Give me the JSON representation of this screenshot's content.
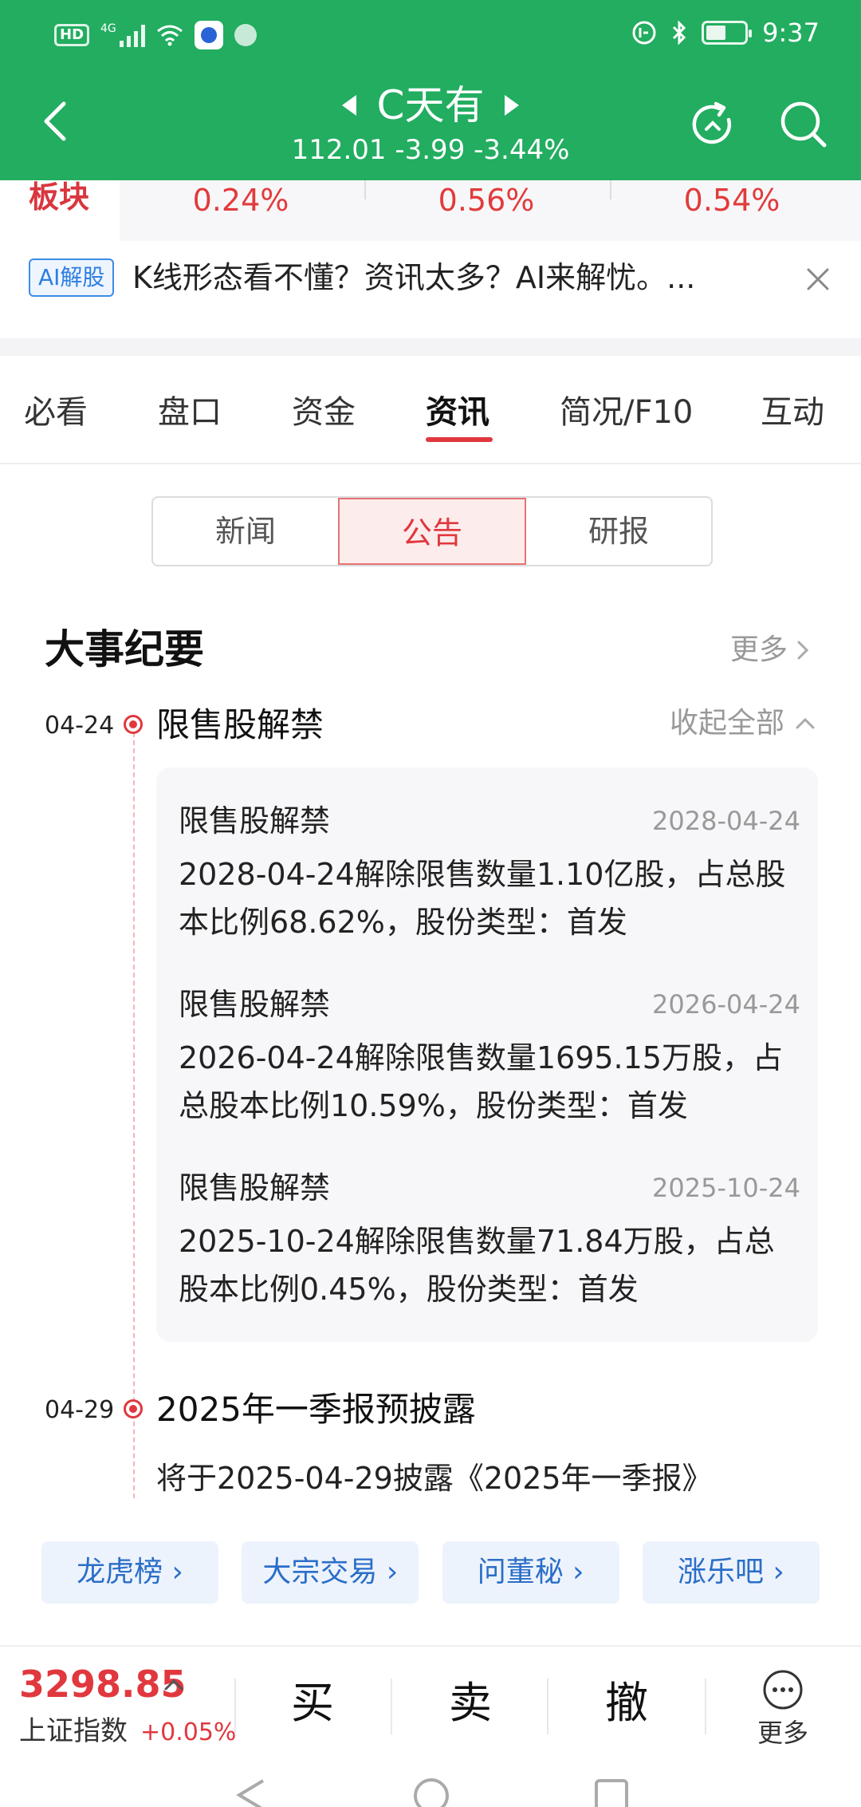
{
  "status_bar": {
    "left_badges": [
      "HD",
      "4G"
    ],
    "time": "9:37"
  },
  "header": {
    "title": "C天有",
    "quote": "112.01 -3.99 -3.44%"
  },
  "sector": {
    "label": "板块",
    "values": [
      "0.24%",
      "0.56%",
      "0.54%"
    ]
  },
  "ai_banner": {
    "badge": "AI解股",
    "text": "K线形态看不懂？资讯太多？AI来解忧。..."
  },
  "tabs": [
    "必看",
    "盘口",
    "资金",
    "资讯",
    "简况/F10",
    "互动"
  ],
  "active_tab": "资讯",
  "segments": [
    "新闻",
    "公告",
    "研报"
  ],
  "active_segment": "公告",
  "events_section": {
    "title": "大事纪要",
    "more": "更多",
    "events": [
      {
        "date": "04-24",
        "title": "限售股解禁",
        "collapse": "收起全部",
        "items": [
          {
            "title": "限售股解禁",
            "date": "2028-04-24",
            "desc": "2028-04-24解除限售数量1.10亿股，占总股本比例68.62%，股份类型：首发"
          },
          {
            "title": "限售股解禁",
            "date": "2026-04-24",
            "desc": "2026-04-24解除限售数量1695.15万股，占总股本比例10.59%，股份类型：首发"
          },
          {
            "title": "限售股解禁",
            "date": "2025-10-24",
            "desc": "2025-10-24解除限售数量71.84万股，占总股本比例0.45%，股份类型：首发"
          }
        ]
      },
      {
        "date": "04-29",
        "title": "2025年一季报预披露",
        "desc": "将于2025-04-29披露《2025年一季报》"
      }
    ]
  },
  "quick_links": [
    "龙虎榜",
    "大宗交易",
    "问董秘",
    "涨乐吧"
  ],
  "bottom_bar": {
    "index_value": "3298.85",
    "index_name": "上证指数",
    "index_change": "+0.05%",
    "buy": "买",
    "sell": "卖",
    "cancel": "撤",
    "more": "更多"
  },
  "colors": {
    "header_green": "#22ad60",
    "accent_red": "#e0383e",
    "link_blue": "#2a6ec8"
  }
}
